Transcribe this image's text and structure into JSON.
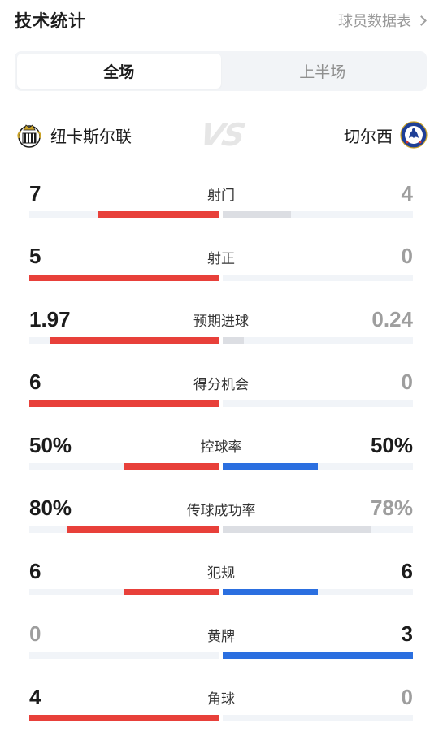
{
  "header": {
    "title": "技术统计",
    "link_label": "球员数据表"
  },
  "tabs": [
    {
      "label": "全场",
      "active": true
    },
    {
      "label": "上半场",
      "active": false
    }
  ],
  "teams": {
    "home": {
      "name": "纽卡斯尔联",
      "crest_icon": "newcastle-crest-icon"
    },
    "away": {
      "name": "切尔西",
      "crest_icon": "chelsea-crest-icon"
    },
    "vs_label": "VS"
  },
  "colors": {
    "home": "#e8403a",
    "away_highlight": "#2b6fe0",
    "away_neutral": "#dcdee3",
    "track": "#f1f4f8"
  },
  "stats": [
    {
      "label": "射门",
      "home": "7",
      "away": "4",
      "home_frac": 0.64,
      "away_frac": 0.36,
      "winner": "home"
    },
    {
      "label": "射正",
      "home": "5",
      "away": "0",
      "home_frac": 1.0,
      "away_frac": 0.0,
      "winner": "home"
    },
    {
      "label": "预期进球",
      "home": "1.97",
      "away": "0.24",
      "home_frac": 0.89,
      "away_frac": 0.11,
      "winner": "home"
    },
    {
      "label": "得分机会",
      "home": "6",
      "away": "0",
      "home_frac": 1.0,
      "away_frac": 0.0,
      "winner": "home"
    },
    {
      "label": "控球率",
      "home": "50%",
      "away": "50%",
      "home_frac": 0.5,
      "away_frac": 0.5,
      "winner": "tie"
    },
    {
      "label": "传球成功率",
      "home": "80%",
      "away": "78%",
      "home_frac": 0.8,
      "away_frac": 0.78,
      "winner": "home"
    },
    {
      "label": "犯规",
      "home": "6",
      "away": "6",
      "home_frac": 0.5,
      "away_frac": 0.5,
      "winner": "tie"
    },
    {
      "label": "黄牌",
      "home": "0",
      "away": "3",
      "home_frac": 0.0,
      "away_frac": 1.0,
      "winner": "away"
    },
    {
      "label": "角球",
      "home": "4",
      "away": "0",
      "home_frac": 1.0,
      "away_frac": 0.0,
      "winner": "home"
    }
  ]
}
